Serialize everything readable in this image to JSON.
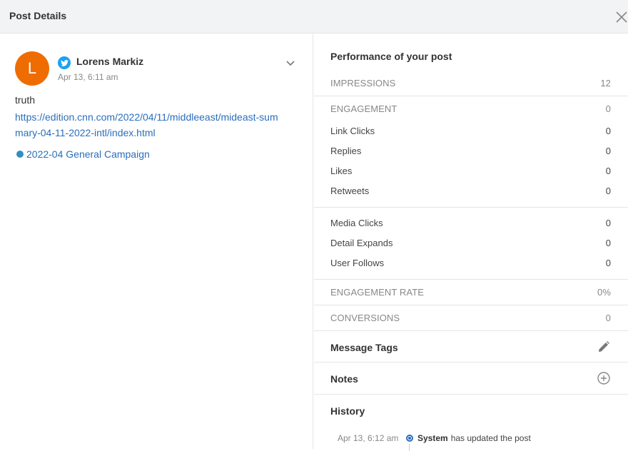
{
  "header": {
    "title": "Post Details"
  },
  "post": {
    "avatar_letter": "L",
    "author": "Lorens Markiz",
    "time": "Apr 13, 6:11 am",
    "text": "truth",
    "link": "https://edition.cnn.com/2022/04/11/middleeast/mideast-summary-04-11-2022-intl/index.html",
    "campaign": "2022-04 General Campaign",
    "campaign_color": "#2f8fc4",
    "network_icon": "twitter-icon"
  },
  "performance": {
    "title": "Performance of your post",
    "impressions": {
      "label": "IMPRESSIONS",
      "value": "12"
    },
    "engagement": {
      "label": "ENGAGEMENT",
      "value": "0"
    },
    "engagement_items": [
      {
        "label": "Link Clicks",
        "value": "0"
      },
      {
        "label": "Replies",
        "value": "0"
      },
      {
        "label": "Likes",
        "value": "0"
      },
      {
        "label": "Retweets",
        "value": "0"
      }
    ],
    "other_items": [
      {
        "label": "Media Clicks",
        "value": "0"
      },
      {
        "label": "Detail Expands",
        "value": "0"
      },
      {
        "label": "User Follows",
        "value": "0"
      }
    ],
    "engagement_rate": {
      "label": "ENGAGEMENT RATE",
      "value": "0%"
    },
    "conversions": {
      "label": "CONVERSIONS",
      "value": "0"
    }
  },
  "sections": {
    "message_tags": "Message Tags",
    "notes": "Notes",
    "history": "History"
  },
  "history": [
    {
      "date": "Apr 13, 6:12 am",
      "actor": "System",
      "text": "has updated the post"
    }
  ]
}
